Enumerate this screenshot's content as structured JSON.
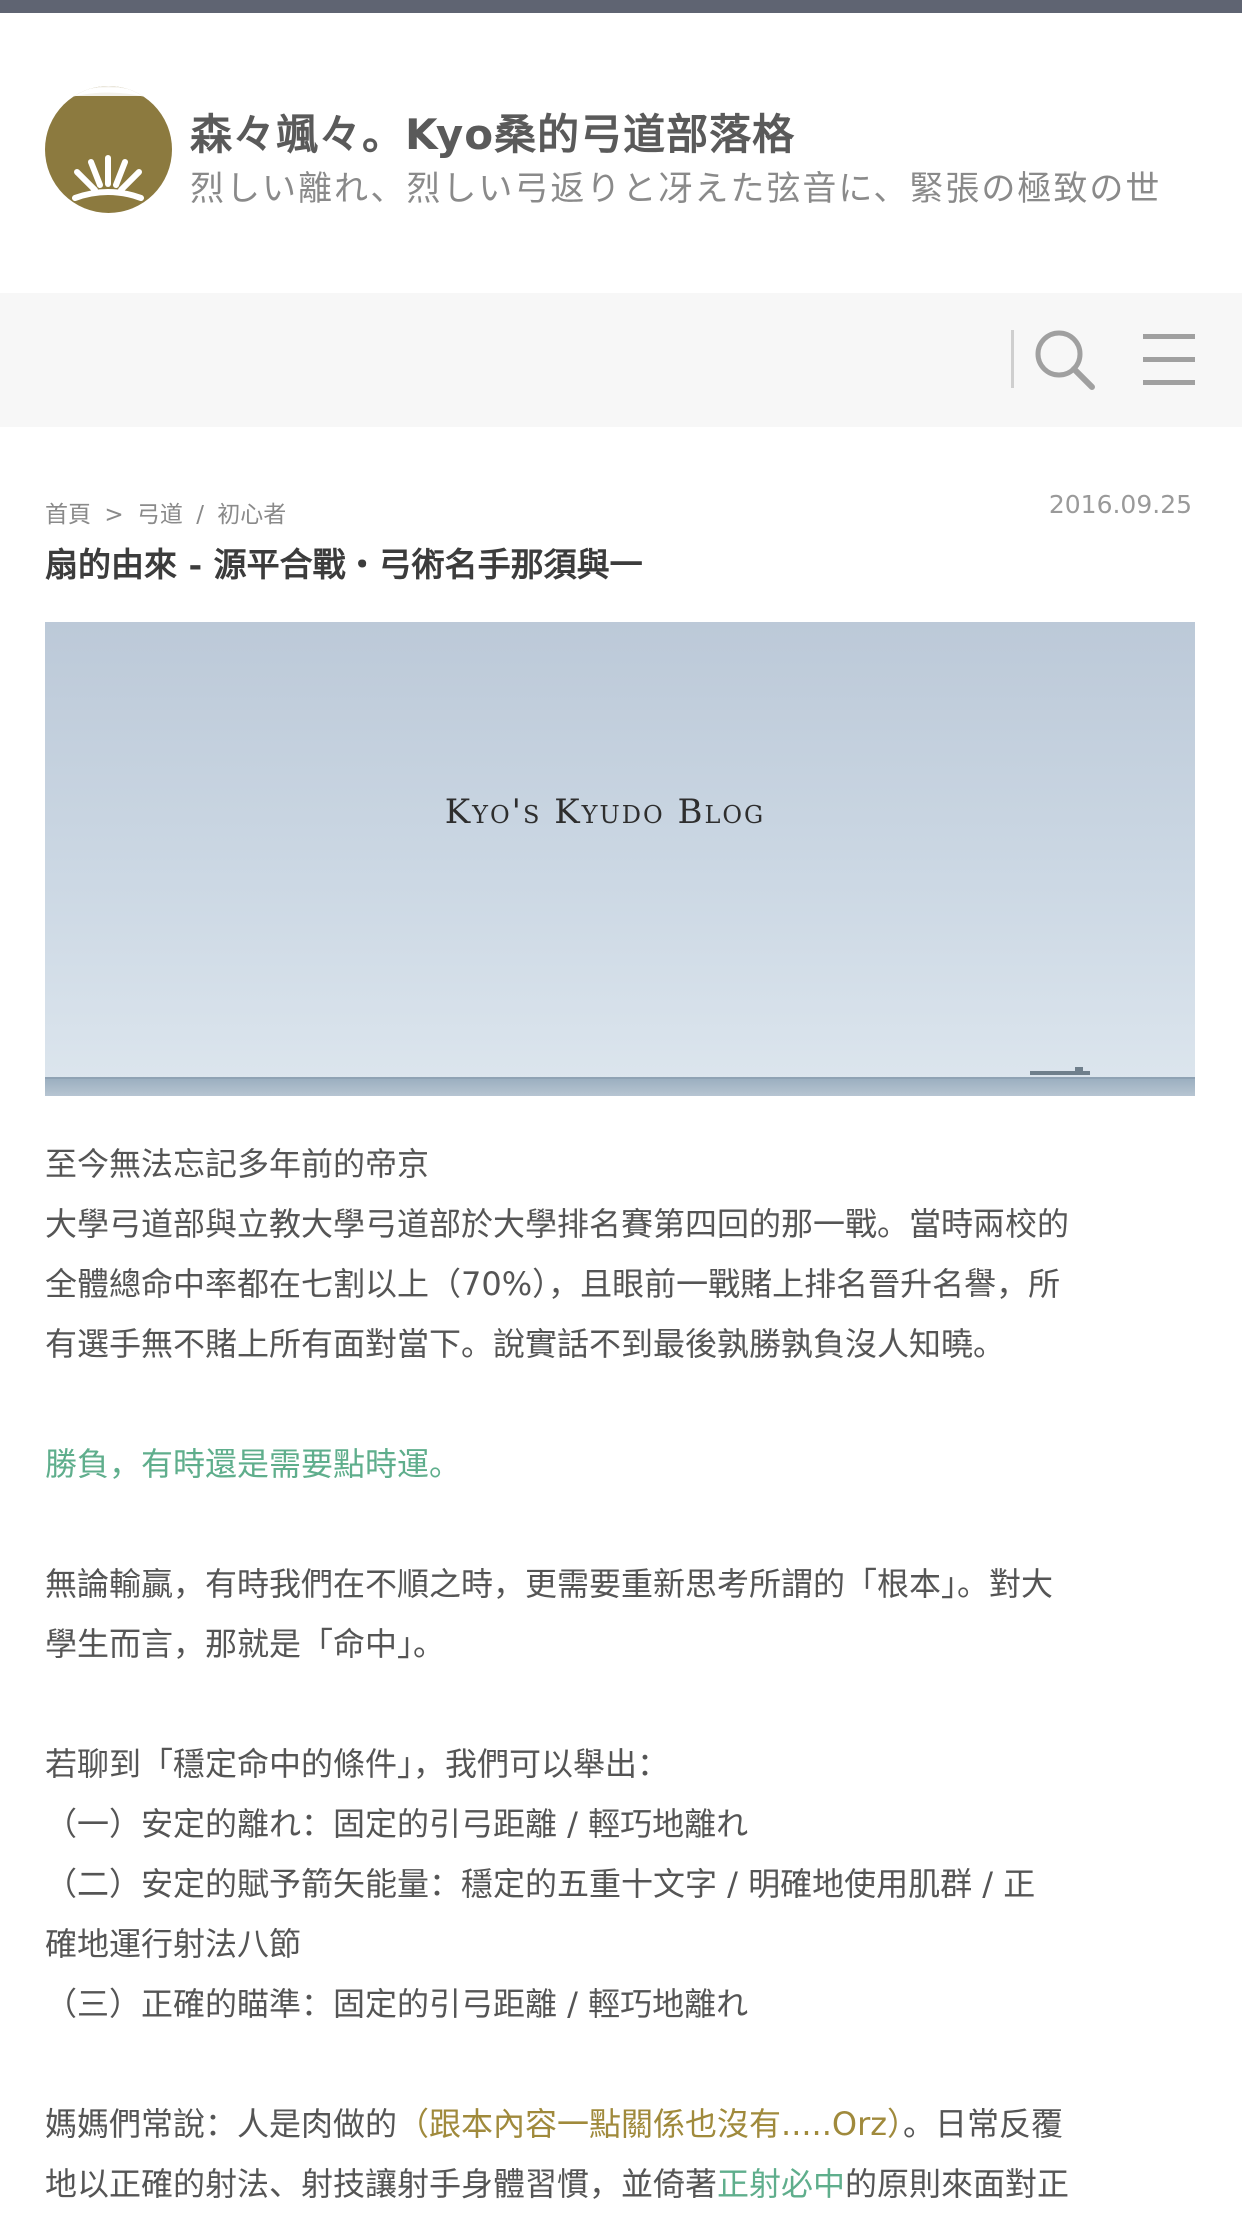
{
  "site": {
    "title": "森々颯々。Kyo桑的弓道部落格",
    "description": "烈しい離れ、烈しい弓返りと冴えた弦音に、緊張の極致の世"
  },
  "nav": {
    "search_icon": "search-icon",
    "menu_icon": "menu-icon"
  },
  "breadcrumb": {
    "home": "首頁",
    "sep1": ">",
    "category": "弓道",
    "sep2": "/",
    "subcategory": "初心者"
  },
  "post": {
    "date": "2016.09.25",
    "title": "扇的由來 - 源平合戰・弓術名手那須與一",
    "hero_caption": "Kyo's Kyudo Blog"
  },
  "content": {
    "p1_l1": "至今無法忘記多年前的帝京",
    "p1_l2": "大學弓道部與立教大學弓道部於大學排名賽第四回的那一戰。當時兩校的",
    "p1_l3": "全體總命中率都在七割以上（70%），且眼前一戰賭上排名晉升名譽，所",
    "p1_l4": "有選手無不賭上所有面對當下。說實話不到最後孰勝孰負沒人知曉。",
    "quote": "勝負，有時還是需要點時運。",
    "p2_l1": "無論輸贏，有時我們在不順之時，更需要重新思考所謂的「根本」。對大",
    "p2_l2": "學生而言，那就是「命中」。",
    "p3_l1": "若聊到「穩定命中的條件」，我們可以舉出：",
    "p3_l2": "（一）安定的離れ：固定的引弓距離 / 輕巧地離れ",
    "p3_l3": "（二）安定的賦予箭矢能量：穩定的五重十文字 / 明確地使用肌群 / 正",
    "p3_l4": "確地運行射法八節",
    "p3_l5": "（三）正確的瞄準：固定的引弓距離 / 輕巧地離れ",
    "p4_l1a": "媽媽們常說：人是肉做的",
    "p4_l1b": "（跟本內容一點關係也沒有.....Orz）",
    "p4_l1c": "。日常反覆",
    "p4_l2a": "地以正確的射法、射技讓射手身體習慣，並倚著",
    "p4_l2b": "正射必中",
    "p4_l2c": "的原則來面對正"
  },
  "colors": {
    "topbar": "#5f6472",
    "logo": "#8c7a3f",
    "accent_green": "#5fae8c",
    "accent_gold": "#a08a3c"
  }
}
